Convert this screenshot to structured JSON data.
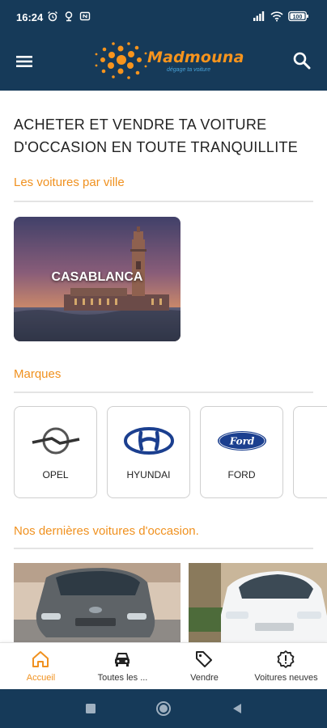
{
  "status_bar": {
    "time": "16:24",
    "battery": "100"
  },
  "app_bar": {
    "logo_name": "Madmouna",
    "logo_tagline": "dégage ta voiture",
    "brand_color": "#163a59",
    "accent_color": "#f0911f"
  },
  "main": {
    "headline": "ACHETER ET VENDRE TA VOITURE D'OCCASION EN TOUTE TRANQUILLITE",
    "cities_title": "Les voitures par ville",
    "cities": [
      {
        "label": "CASABLANCA"
      }
    ],
    "brands_title": "Marques",
    "brands": [
      {
        "name": "OPEL",
        "icon": "opel-logo-icon"
      },
      {
        "name": "HYUNDAI",
        "icon": "hyundai-logo-icon"
      },
      {
        "name": "FORD",
        "icon": "ford-logo-icon"
      }
    ],
    "latest_title": "Nos dernières voitures d'occasion."
  },
  "bottom_nav": [
    {
      "label": "Accueil",
      "icon": "home-icon",
      "active": true
    },
    {
      "label": "Toutes les ...",
      "icon": "car-icon",
      "active": false
    },
    {
      "label": "Vendre",
      "icon": "tag-icon",
      "active": false
    },
    {
      "label": "Voitures neuves",
      "icon": "badge-alert-icon",
      "active": false
    }
  ]
}
